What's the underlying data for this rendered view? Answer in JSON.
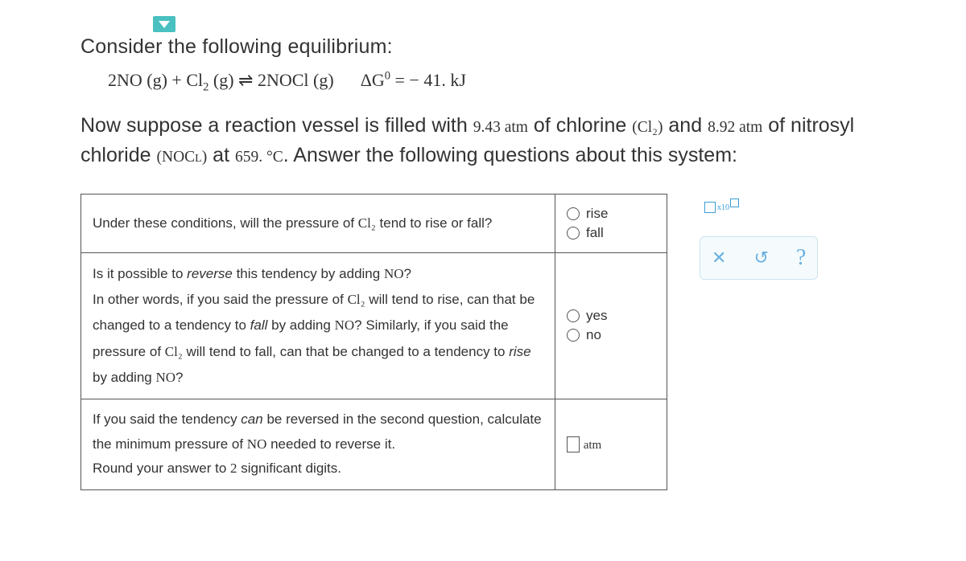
{
  "heading1": "Consider the following equilibrium:",
  "equation": {
    "lhs": "2NO (g) + Cl",
    "lhs_sub": "2",
    "lhs2": " (g) ⇌ 2NOCl (g)",
    "deltaG": "ΔG",
    "sup": "0",
    "eq": " = − 41. kJ"
  },
  "paragraph1_a": "Now suppose a reaction vessel is filled with ",
  "pressure_cl2": "9.43 atm",
  "paragraph1_b": " of chlorine ",
  "cl2_label": "(Cl₂)",
  "paragraph1_c": " and ",
  "pressure_nocl": "8.92 atm",
  "paragraph1_d": " of nitrosyl chloride ",
  "nocl_label": "(NOCl)",
  "paragraph1_e": " at ",
  "temperature": "659. °C",
  "paragraph1_f": ". Answer the following questions about this system:",
  "questions": {
    "q1": {
      "text_a": "Under these conditions, will the pressure of ",
      "chem": "Cl₂",
      "text_b": " tend to rise or fall?",
      "opt1": "rise",
      "opt2": "fall"
    },
    "q2": {
      "line1_a": "Is it possible to ",
      "italic1": "reverse",
      "line1_b": " this tendency by adding ",
      "chem1": "NO",
      "line1_c": "?",
      "line2_a": "In other words, if you said the pressure of ",
      "chem2": "Cl₂",
      "line2_b": " will tend to rise, can that be changed to a tendency to ",
      "italic2": "fall",
      "line2_c": " by adding ",
      "chem3": "NO",
      "line2_d": "? Similarly, if you said the pressure of ",
      "chem4": "Cl₂",
      "line2_e": " will tend to fall, can that be changed to a tendency to ",
      "italic3": "rise",
      "line2_f": " by adding ",
      "chem5": "NO",
      "line2_g": "?",
      "opt1": "yes",
      "opt2": "no"
    },
    "q3": {
      "line1_a": "If you said the tendency ",
      "italic1": "can",
      "line1_b": " be reversed in the second question, calculate the minimum pressure of ",
      "chem1": "NO",
      "line1_c": " needed to reverse it.",
      "line2_a": "Round your answer to ",
      "num": "2",
      "line2_b": " significant digits.",
      "unit": "atm"
    }
  },
  "controls": {
    "x10_label": "x10",
    "clear_icon": "✕",
    "reset_icon": "↺",
    "help_icon": "?"
  }
}
